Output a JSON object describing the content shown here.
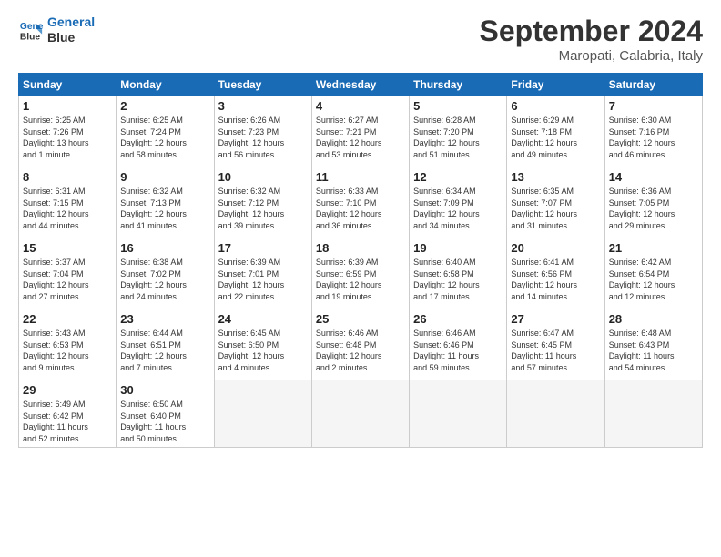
{
  "logo": {
    "line1": "General",
    "line2": "Blue"
  },
  "title": "September 2024",
  "location": "Maropati, Calabria, Italy",
  "weekdays": [
    "Sunday",
    "Monday",
    "Tuesday",
    "Wednesday",
    "Thursday",
    "Friday",
    "Saturday"
  ],
  "weeks": [
    [
      {
        "day": "1",
        "info": "Sunrise: 6:25 AM\nSunset: 7:26 PM\nDaylight: 13 hours\nand 1 minute."
      },
      {
        "day": "2",
        "info": "Sunrise: 6:25 AM\nSunset: 7:24 PM\nDaylight: 12 hours\nand 58 minutes."
      },
      {
        "day": "3",
        "info": "Sunrise: 6:26 AM\nSunset: 7:23 PM\nDaylight: 12 hours\nand 56 minutes."
      },
      {
        "day": "4",
        "info": "Sunrise: 6:27 AM\nSunset: 7:21 PM\nDaylight: 12 hours\nand 53 minutes."
      },
      {
        "day": "5",
        "info": "Sunrise: 6:28 AM\nSunset: 7:20 PM\nDaylight: 12 hours\nand 51 minutes."
      },
      {
        "day": "6",
        "info": "Sunrise: 6:29 AM\nSunset: 7:18 PM\nDaylight: 12 hours\nand 49 minutes."
      },
      {
        "day": "7",
        "info": "Sunrise: 6:30 AM\nSunset: 7:16 PM\nDaylight: 12 hours\nand 46 minutes."
      }
    ],
    [
      {
        "day": "8",
        "info": "Sunrise: 6:31 AM\nSunset: 7:15 PM\nDaylight: 12 hours\nand 44 minutes."
      },
      {
        "day": "9",
        "info": "Sunrise: 6:32 AM\nSunset: 7:13 PM\nDaylight: 12 hours\nand 41 minutes."
      },
      {
        "day": "10",
        "info": "Sunrise: 6:32 AM\nSunset: 7:12 PM\nDaylight: 12 hours\nand 39 minutes."
      },
      {
        "day": "11",
        "info": "Sunrise: 6:33 AM\nSunset: 7:10 PM\nDaylight: 12 hours\nand 36 minutes."
      },
      {
        "day": "12",
        "info": "Sunrise: 6:34 AM\nSunset: 7:09 PM\nDaylight: 12 hours\nand 34 minutes."
      },
      {
        "day": "13",
        "info": "Sunrise: 6:35 AM\nSunset: 7:07 PM\nDaylight: 12 hours\nand 31 minutes."
      },
      {
        "day": "14",
        "info": "Sunrise: 6:36 AM\nSunset: 7:05 PM\nDaylight: 12 hours\nand 29 minutes."
      }
    ],
    [
      {
        "day": "15",
        "info": "Sunrise: 6:37 AM\nSunset: 7:04 PM\nDaylight: 12 hours\nand 27 minutes."
      },
      {
        "day": "16",
        "info": "Sunrise: 6:38 AM\nSunset: 7:02 PM\nDaylight: 12 hours\nand 24 minutes."
      },
      {
        "day": "17",
        "info": "Sunrise: 6:39 AM\nSunset: 7:01 PM\nDaylight: 12 hours\nand 22 minutes."
      },
      {
        "day": "18",
        "info": "Sunrise: 6:39 AM\nSunset: 6:59 PM\nDaylight: 12 hours\nand 19 minutes."
      },
      {
        "day": "19",
        "info": "Sunrise: 6:40 AM\nSunset: 6:58 PM\nDaylight: 12 hours\nand 17 minutes."
      },
      {
        "day": "20",
        "info": "Sunrise: 6:41 AM\nSunset: 6:56 PM\nDaylight: 12 hours\nand 14 minutes."
      },
      {
        "day": "21",
        "info": "Sunrise: 6:42 AM\nSunset: 6:54 PM\nDaylight: 12 hours\nand 12 minutes."
      }
    ],
    [
      {
        "day": "22",
        "info": "Sunrise: 6:43 AM\nSunset: 6:53 PM\nDaylight: 12 hours\nand 9 minutes."
      },
      {
        "day": "23",
        "info": "Sunrise: 6:44 AM\nSunset: 6:51 PM\nDaylight: 12 hours\nand 7 minutes."
      },
      {
        "day": "24",
        "info": "Sunrise: 6:45 AM\nSunset: 6:50 PM\nDaylight: 12 hours\nand 4 minutes."
      },
      {
        "day": "25",
        "info": "Sunrise: 6:46 AM\nSunset: 6:48 PM\nDaylight: 12 hours\nand 2 minutes."
      },
      {
        "day": "26",
        "info": "Sunrise: 6:46 AM\nSunset: 6:46 PM\nDaylight: 11 hours\nand 59 minutes."
      },
      {
        "day": "27",
        "info": "Sunrise: 6:47 AM\nSunset: 6:45 PM\nDaylight: 11 hours\nand 57 minutes."
      },
      {
        "day": "28",
        "info": "Sunrise: 6:48 AM\nSunset: 6:43 PM\nDaylight: 11 hours\nand 54 minutes."
      }
    ],
    [
      {
        "day": "29",
        "info": "Sunrise: 6:49 AM\nSunset: 6:42 PM\nDaylight: 11 hours\nand 52 minutes."
      },
      {
        "day": "30",
        "info": "Sunrise: 6:50 AM\nSunset: 6:40 PM\nDaylight: 11 hours\nand 50 minutes."
      },
      {
        "day": "",
        "info": ""
      },
      {
        "day": "",
        "info": ""
      },
      {
        "day": "",
        "info": ""
      },
      {
        "day": "",
        "info": ""
      },
      {
        "day": "",
        "info": ""
      }
    ]
  ]
}
